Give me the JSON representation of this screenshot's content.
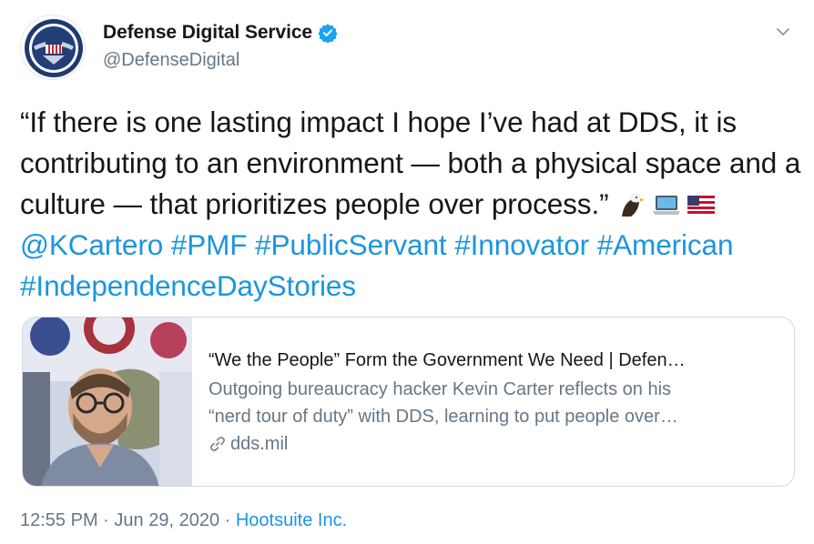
{
  "author": {
    "display_name": "Defense Digital Service",
    "handle": "@DefenseDigital",
    "avatar_icon": "dds-seal-avatar",
    "verified_icon": "verified-badge-icon",
    "verified_color": "#1da1f2"
  },
  "tweet": {
    "text_main": "“If there is one lasting impact I hope I’ve had at DDS, it is contributing to an environment — both a physical space and a culture — that prioritizes people over process.”",
    "emojis": [
      "eagle-emoji",
      "laptop-emoji",
      "us-flag-emoji"
    ],
    "mention": "@KCartero",
    "hashtags": [
      "#PMF",
      "#PublicServant",
      "#Innovator",
      "#American",
      "#IndependenceDayStories"
    ],
    "link_color": "#1b95e0"
  },
  "card": {
    "title": "“We the People” Form the Government We Need | Defen…",
    "description_line1": "Outgoing bureaucracy hacker Kevin Carter reflects on his",
    "description_line2": "“nerd tour of duty” with DDS, learning to put people over…",
    "domain": "dds.mil",
    "image": "card-thumbnail-photo"
  },
  "meta": {
    "time": "12:55 PM",
    "separator": "·",
    "date": "Jun 29, 2020",
    "source": "Hootsuite Inc."
  }
}
